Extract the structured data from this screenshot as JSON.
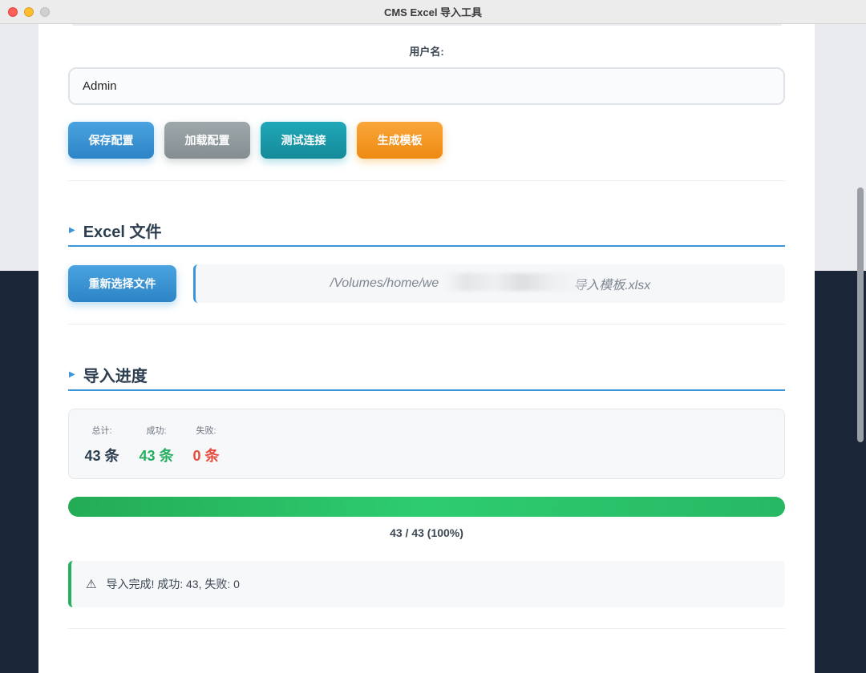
{
  "window": {
    "title": "CMS Excel 导入工具"
  },
  "config": {
    "username_label": "用户名:",
    "username_value": "Admin",
    "buttons": {
      "save": "保存配置",
      "load": "加载配置",
      "test": "测试连接",
      "generate": "生成模板"
    }
  },
  "excel_section": {
    "title": "Excel 文件",
    "reselect_button": "重新选择文件",
    "file_path_start": "/Volumes/home/we",
    "file_path_end": "导入模板.xlsx"
  },
  "progress_section": {
    "title": "导入进度",
    "stats": [
      {
        "label": "总计:",
        "value": "43 条",
        "color": "#2c3e50"
      },
      {
        "label": "成功:",
        "value": "43 条",
        "color": "#27ae60"
      },
      {
        "label": "失败:",
        "value": "0 条",
        "color": "#e74c3c"
      }
    ],
    "progress_fraction": 1.0,
    "progress_text": "43 / 43 (100%)",
    "alert_icon": "warning-icon",
    "alert_text": "导入完成! 成功: 43, 失败: 0"
  },
  "colors": {
    "accent": "#3498db",
    "success": "#27ae60",
    "danger": "#e74c3c",
    "warning": "#f39c12",
    "info": "#17a2b8",
    "muted": "#95a5a6"
  }
}
